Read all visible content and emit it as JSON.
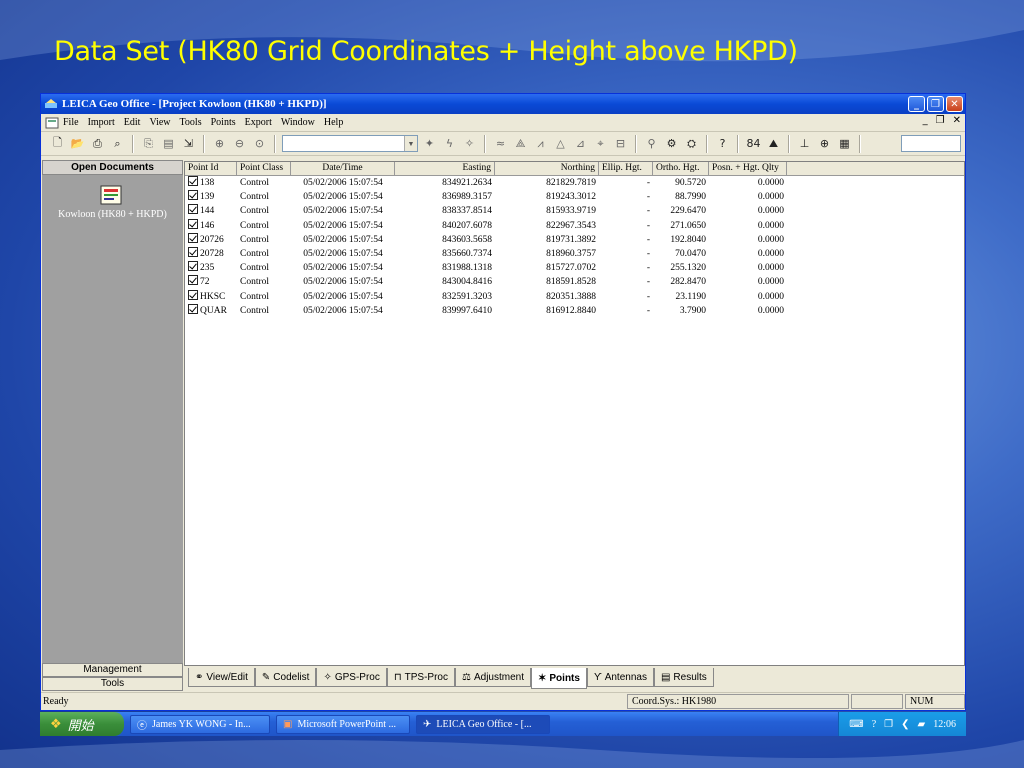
{
  "slide": {
    "title": "Data Set (HK80 Grid Coordinates + Height above HKPD)"
  },
  "window": {
    "title": "LEICA Geo Office - [Project Kowloon (HK80 + HKPD)]",
    "controls": {
      "minimize": "_",
      "restore": "❐",
      "close": "✕"
    }
  },
  "menu": {
    "items": [
      "File",
      "Import",
      "Edit",
      "View",
      "Tools",
      "Points",
      "Export",
      "Window",
      "Help"
    ],
    "mdi": {
      "minimize": "_",
      "restore": "❐",
      "close": "✕"
    }
  },
  "toolbar": {
    "count": "84"
  },
  "sidebar": {
    "header": "Open Documents",
    "document": "Kowloon (HK80 + HKPD)",
    "tabs": [
      "Management",
      "Tools"
    ]
  },
  "grid": {
    "columns": [
      "Point Id",
      "Point Class",
      "Date/Time",
      "Easting",
      "Northing",
      "Ellip. Hgt.",
      "Ortho. Hgt.",
      "Posn. + Hgt. Qlty"
    ],
    "rows": [
      [
        "138",
        "Control",
        "05/02/2006 15:07:54",
        "834921.2634",
        "821829.7819",
        "-",
        "90.5720",
        "0.0000"
      ],
      [
        "139",
        "Control",
        "05/02/2006 15:07:54",
        "836989.3157",
        "819243.3012",
        "-",
        "88.7990",
        "0.0000"
      ],
      [
        "144",
        "Control",
        "05/02/2006 15:07:54",
        "838337.8514",
        "815933.9719",
        "-",
        "229.6470",
        "0.0000"
      ],
      [
        "146",
        "Control",
        "05/02/2006 15:07:54",
        "840207.6078",
        "822967.3543",
        "-",
        "271.0650",
        "0.0000"
      ],
      [
        "20726",
        "Control",
        "05/02/2006 15:07:54",
        "843603.5658",
        "819731.3892",
        "-",
        "192.8040",
        "0.0000"
      ],
      [
        "20728",
        "Control",
        "05/02/2006 15:07:54",
        "835660.7374",
        "818960.3757",
        "-",
        "70.0470",
        "0.0000"
      ],
      [
        "235",
        "Control",
        "05/02/2006 15:07:54",
        "831988.1318",
        "815727.0702",
        "-",
        "255.1320",
        "0.0000"
      ],
      [
        "72",
        "Control",
        "05/02/2006 15:07:54",
        "843004.8416",
        "818591.8528",
        "-",
        "282.8470",
        "0.0000"
      ],
      [
        "HKSC",
        "Control",
        "05/02/2006 15:07:54",
        "832591.3203",
        "820351.3888",
        "-",
        "23.1190",
        "0.0000"
      ],
      [
        "QUAR",
        "Control",
        "05/02/2006 15:07:54",
        "839997.6410",
        "816912.8840",
        "-",
        "3.7900",
        "0.0000"
      ]
    ]
  },
  "tabs": [
    "View/Edit",
    "Codelist",
    "GPS-Proc",
    "TPS-Proc",
    "Adjustment",
    "Points",
    "Antennas",
    "Results"
  ],
  "active_tab": "Points",
  "status": {
    "ready": "Ready",
    "coord": "Coord.Sys.: HK1980",
    "num": "NUM"
  },
  "taskbar": {
    "start": "開始",
    "tasks": [
      "James YK WONG - In...",
      "Microsoft PowerPoint ...",
      "LEICA Geo Office - [..."
    ],
    "clock": "12:06"
  }
}
